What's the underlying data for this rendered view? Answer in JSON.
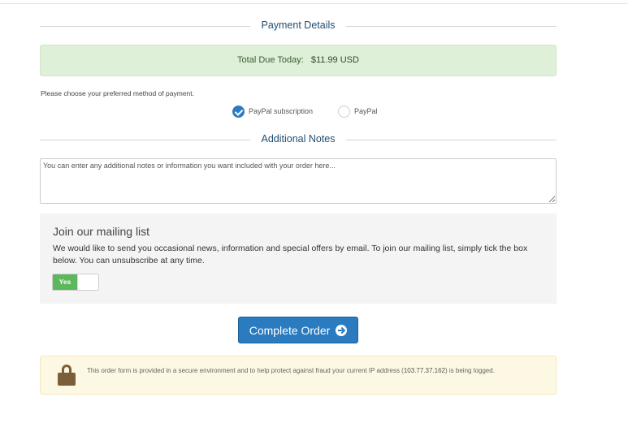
{
  "payment_section": {
    "title": "Payment Details"
  },
  "total": {
    "label": "Total Due Today:",
    "amount": "$11.99 USD"
  },
  "payment_method": {
    "prompt": "Please choose your preferred method of payment.",
    "options": [
      {
        "label": "PayPal subscription",
        "selected": true
      },
      {
        "label": "PayPal",
        "selected": false
      }
    ]
  },
  "notes_section": {
    "title": "Additional Notes",
    "placeholder": "You can enter any additional notes or information you want included with your order here..."
  },
  "mailing": {
    "title": "Join our mailing list",
    "description": "We would like to send you occasional news, information and special offers by email. To join our mailing list, simply tick the box below. You can unsubscribe at any time.",
    "toggle_label": "Yes",
    "toggle_on": true
  },
  "submit": {
    "label": "Complete Order",
    "icon": "arrow-circle-right-icon"
  },
  "security": {
    "icon": "lock-icon",
    "text_before": "This order form is provided in a secure environment and to help protect against fraud your current IP address (",
    "ip": "103.77.37.162",
    "text_after": ") is being logged."
  },
  "colors": {
    "accent": "#2b7bc0",
    "success_bg": "#dff0d8",
    "toggle_on": "#5cb85c",
    "warning_bg": "#fcf8e3"
  }
}
